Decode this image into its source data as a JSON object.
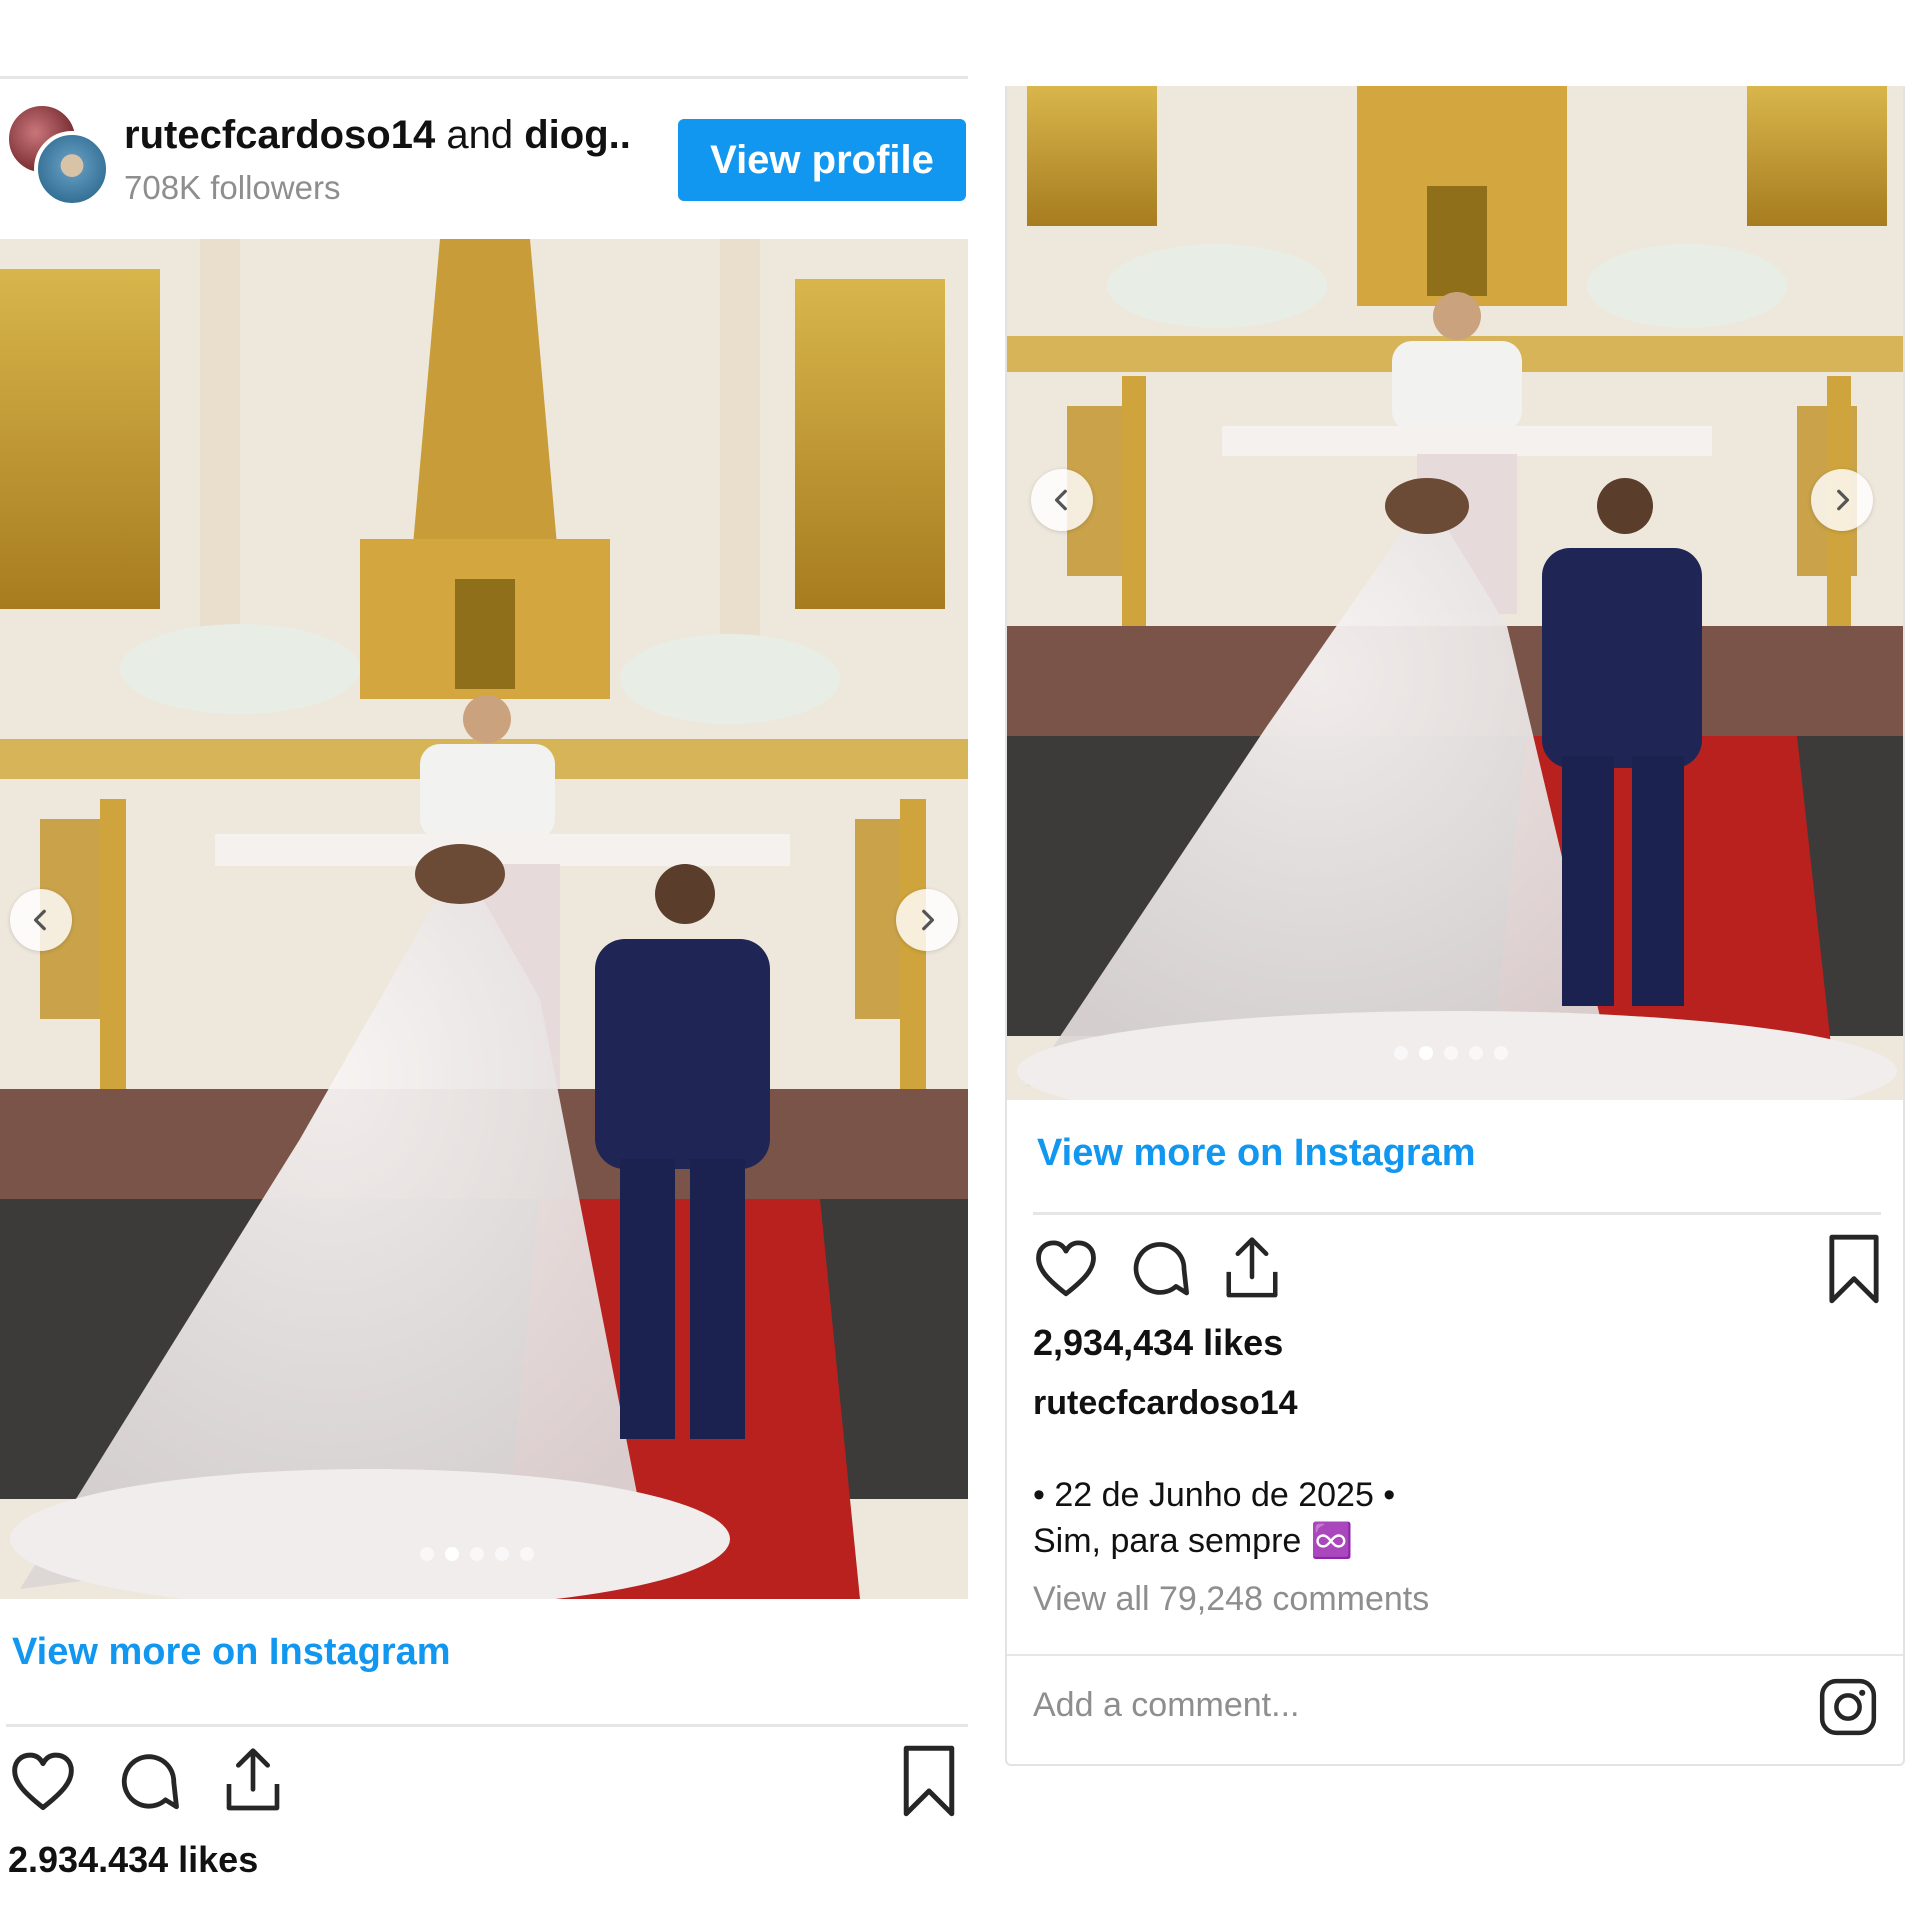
{
  "left_post": {
    "header": {
      "username": "rutecfcardoso14",
      "and_text": "and",
      "coauthor": "diog..",
      "followers": "708K followers",
      "view_profile_label": "View profile"
    },
    "carousel": {
      "slides": 5,
      "active_index": 1
    },
    "view_more_label": "View more on Instagram",
    "likes": "2.934.434 likes"
  },
  "right_post": {
    "carousel": {
      "slides": 5,
      "active_index": 1
    },
    "view_more_label": "View more on Instagram",
    "likes": "2,934,434 likes",
    "caption_user": "rutecfcardoso14",
    "caption_line1": "• 22 de Junho de 2025 •",
    "caption_line2": "Sim, para sempre ♾️",
    "view_comments": "View all 79,248 comments",
    "add_comment_placeholder": "Add a comment..."
  },
  "colors": {
    "accent": "#1197f0",
    "muted": "#8e8e8e",
    "text": "#262626"
  },
  "icons": [
    "chevron-left-icon",
    "chevron-right-icon",
    "heart-icon",
    "comment-icon",
    "share-icon",
    "bookmark-icon",
    "instagram-icon"
  ]
}
